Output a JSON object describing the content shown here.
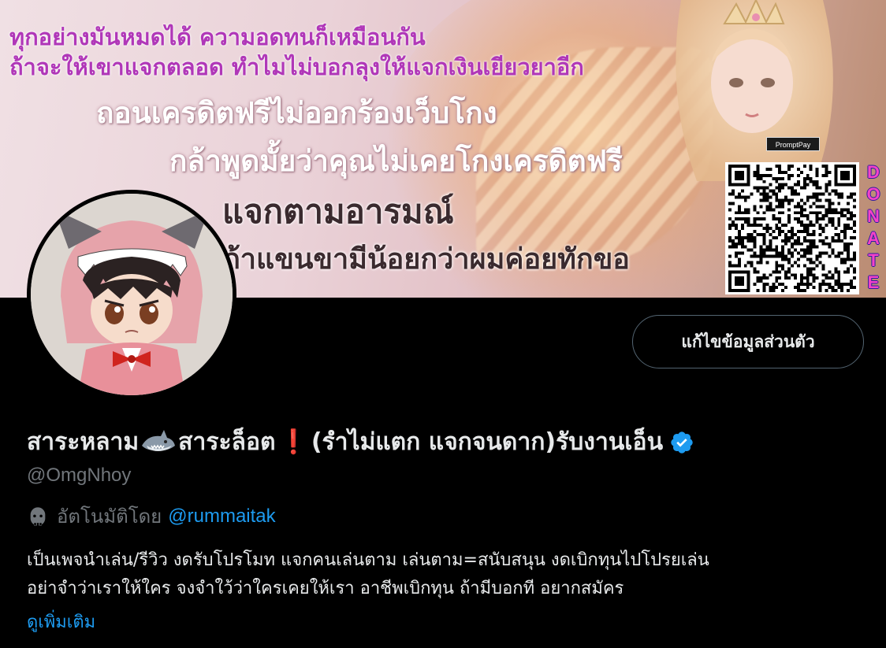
{
  "banner": {
    "lines": [
      "ทุกอย่างมันหมดได้  ความอดทนก็เหมือนกัน",
      "ถ้าจะให้เขาแจกตลอด ทำไมไม่บอกลุงให้แจกเงินเยียวยาอีก",
      "ถอนเครดิตฟรีไม่ออกร้องเว็บโกง",
      "กล้าพูดมั้ยว่าคุณไม่เคยโกงเครดิตฟรี",
      "แจกตามอารมณ์",
      "ถ้าแขนขามีน้อยกว่าผมค่อยทักขอ"
    ],
    "promptpay_label": "PromptPay",
    "donate_letters": [
      "D",
      "O",
      "N",
      "A",
      "T",
      "E"
    ]
  },
  "profile": {
    "edit_button_label": "แก้ไขข้อมูลส่วนตัว",
    "name_part1": "สาระหลาม",
    "name_part2": "สาระล็อต",
    "name_exclaim": "❗",
    "name_part3": " (รำไม่แตก แจกจนดาก)รับงานเอ็น",
    "handle": "@OmgNhoy",
    "automated_label": "อัตโนมัติโดย",
    "automated_by": "@rummaitak",
    "bio_lines": [
      "เป็นเพจนำเล่น/รีวิว งดรับโปรโมท แจกคนเล่นตาม เล่นตาม=สนับสนุน งดเบิกทุนไปโปรยเล่น",
      "อย่าจำว่าเราให้ใคร จงจำใว้ว่าใครเคยให้เรา อาชีพเบิกทุน ถ้ามีบอกที อยากสมัคร"
    ],
    "see_more_label": "ดูเพิ่มเติม"
  },
  "colors": {
    "background": "#000000",
    "text_primary": "#e7e9ea",
    "text_secondary": "#71767b",
    "link": "#1d9bf0",
    "verified": "#1d9bf0",
    "button_border": "#536471",
    "banner_purple": "#b037b8",
    "donate_pink": "#f542c8"
  },
  "icons": {
    "verified": "verified-badge-icon",
    "bot": "robot-icon",
    "shark": "shark-emoji-icon",
    "exclaim": "red-exclamation-icon"
  }
}
